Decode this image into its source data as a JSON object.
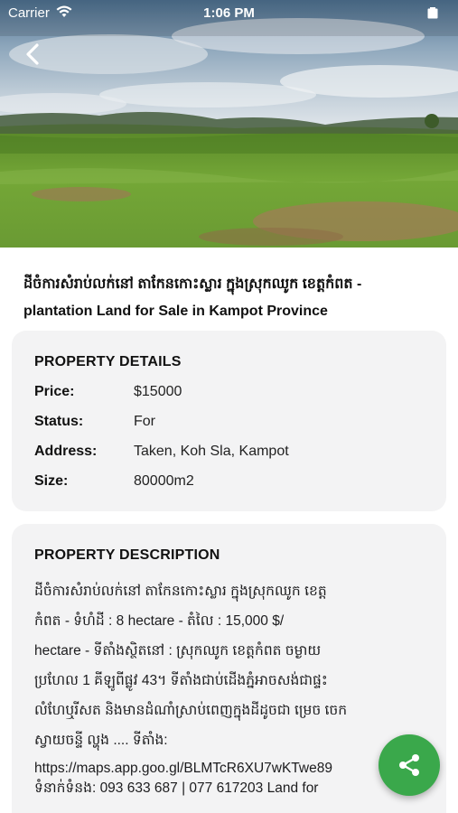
{
  "status_bar": {
    "carrier": "Carrier",
    "time": "1:06 PM"
  },
  "navigation": {
    "back_icon": "chevron-left-icon"
  },
  "hero_image": {
    "subject": "green plantation land with hills and cloudy sky"
  },
  "listing": {
    "title_line1": "ដីចំការសំរាប់លក់នៅ តាកែនកោះស្លារ ក្នុងស្រុកឈូក ខេត្តកំពត -",
    "title_line2": "plantation Land for Sale in Kampot Province"
  },
  "property_details": {
    "heading": "PROPERTY DETAILS",
    "rows": [
      {
        "label": "Price:",
        "value": "$15000"
      },
      {
        "label": "Status:",
        "value": "For"
      },
      {
        "label": "Address:",
        "value": "Taken, Koh Sla, Kampot"
      },
      {
        "label": "Size:",
        "value": "80000m2"
      }
    ]
  },
  "property_description": {
    "heading": "PROPERTY DESCRIPTION",
    "lines": [
      "    ដីចំការសំរាប់លក់នៅ តាកែនកោះស្លារ ក្នុងស្រុកឈូក ខេត្ត",
      "កំពត     -  ទំហំដី : 8 hectare      -  តំលៃ : 15,000 $/",
      "hectare      -  ទីតាំងស្ថិតនៅ : ស្រុកឈូក ខេត្តកំពត ចម្ងាយ",
      "ប្រហែល 1 គីឡូពីផ្លូវ 43។     ទីតាំងជាប់ដើងភ្នំអាចសង់ជាផ្ទះ",
      "លំហែឬរីសត និងមានដំណាំស្រាប់ពេញក្នុងដីដូចជា ម្រេច ចេក",
      "ស្វាយចន្ទី ល្ហុង ....        ទីតាំង:",
      "https://maps.app.goo.gl/BLMTcR6XU7wKTwe89",
      "ទំនាក់ទំនង: 093 633 687 | 077 617203          Land for"
    ]
  },
  "share_button": {
    "icon": "share-icon",
    "color": "#3aa84b"
  }
}
